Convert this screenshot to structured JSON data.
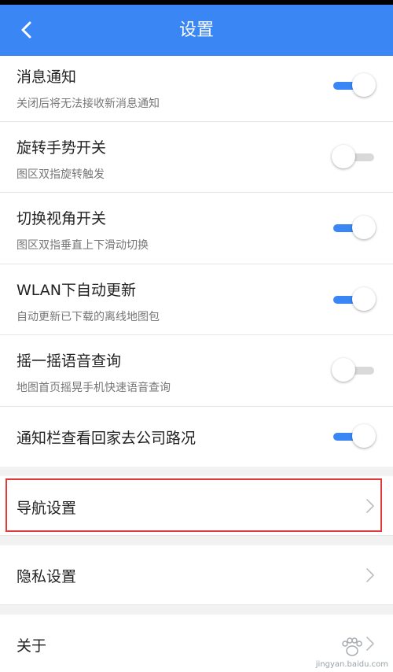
{
  "header": {
    "title": "设置"
  },
  "settings": [
    {
      "title": "消息通知",
      "subtitle": "关闭后将无法接收新消息通知",
      "state": "on"
    },
    {
      "title": "旋转手势开关",
      "subtitle": "图区双指旋转触发",
      "state": "off"
    },
    {
      "title": "切换视角开关",
      "subtitle": "图区双指垂直上下滑动切换",
      "state": "on"
    },
    {
      "title": "WLAN下自动更新",
      "subtitle": "自动更新已下载的离线地图包",
      "state": "on"
    },
    {
      "title": "摇一摇语音查询",
      "subtitle": "地图首页摇晃手机快速语音查询",
      "state": "off"
    },
    {
      "title": "通知栏查看回家去公司路况",
      "state": "on"
    }
  ],
  "nav_items": [
    {
      "label": "导航设置"
    },
    {
      "label": "隐私设置"
    },
    {
      "label": "关于"
    }
  ],
  "watermark": {
    "text": "jingyan.baidu.com"
  },
  "colors": {
    "accent": "#3a86f4",
    "highlight": "#e03a3a"
  }
}
